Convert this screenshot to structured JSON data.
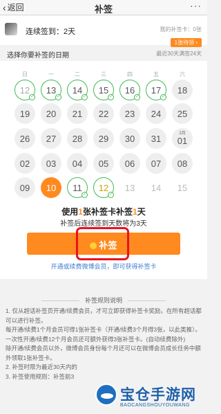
{
  "nav": {
    "back_label": "返回",
    "title": "补签",
    "more_label": "···"
  },
  "user": {
    "streak_text": "连续签到：2天",
    "my_cards_text": "我的补签卡：0张",
    "pending_badge": "1张待领 ›"
  },
  "calendar": {
    "select_label": "选择你要补签的日期",
    "recent_text": "最近30天满签24天",
    "weekdays": [
      "日",
      "一",
      "二",
      "三",
      "四",
      "五",
      "六"
    ],
    "rows": [
      [
        "12",
        "13",
        "14",
        "15",
        "16",
        "17",
        "18"
      ],
      [
        "19",
        "20",
        "21",
        "22",
        "23",
        "24",
        "25"
      ],
      [
        "26",
        "27",
        "28",
        "29",
        "30",
        "31",
        "01"
      ],
      [
        "02",
        "03",
        "04",
        "05",
        "06",
        "07",
        "08"
      ],
      [
        "09",
        "10",
        "11",
        "12",
        "13",
        "14",
        "15"
      ]
    ],
    "month_marker": "2月",
    "check_glyph": "✓"
  },
  "info": {
    "headline_pre": "使用",
    "headline_hl1": "1",
    "headline_mid": "张补签卡补签",
    "headline_hl2": "1",
    "headline_post": "天",
    "subline": "补签后连续签到天数将为3天",
    "button_label": "补签",
    "vip_link": "开通或续费微博会员，即可获得补签卡"
  },
  "rules": {
    "title": "补签规则说明",
    "items": [
      "1. 仅从超话补签页开通/续费会员，才可立即获得补签卡奖励，在所有超话都可以进行补签。",
      "每开通/续费1个月会员可得1张补签卡（开通/续费3个月得3张，以此类推）。",
      "一次性开通/续费12个月会员还可额外获得3张补签卡。(自动续费除外)",
      "除开通/续费会员以外，微博会员身份每个月还可以在微博会员成长任务中额外领取1张补签卡。",
      "2. 补签时限为最近30天内的",
      "3. 补签使用规则：补签前3"
    ]
  },
  "watermark": {
    "title": "宝仓手游网",
    "subtitle": "BAOCANGSHOUYOUWANG"
  },
  "colors": {
    "accent": "#ff8a1f",
    "signed_ring": "#3fba52",
    "highlight": "#e8121f",
    "link": "#3f7fd0"
  }
}
